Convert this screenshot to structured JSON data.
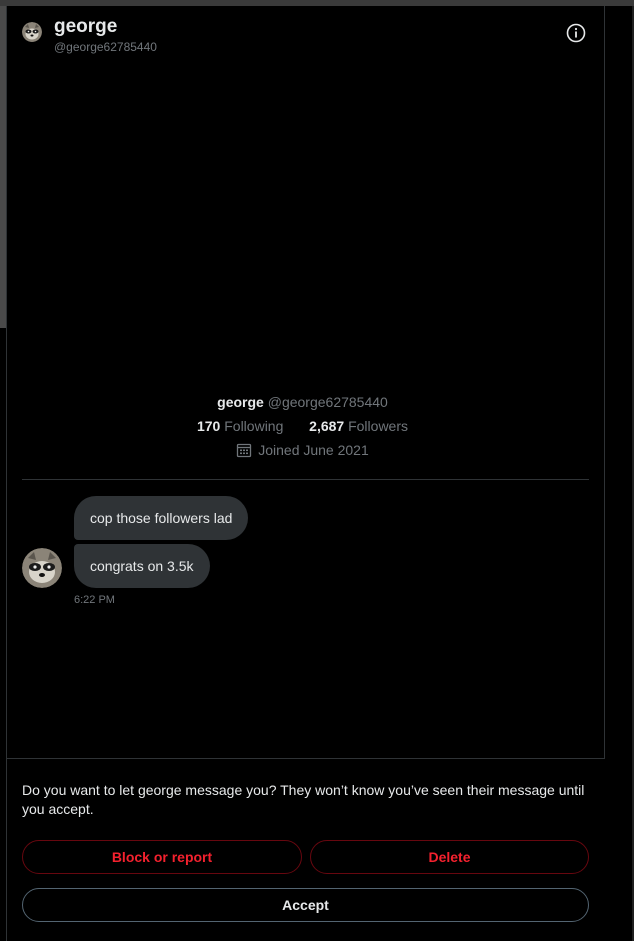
{
  "header": {
    "name": "george",
    "handle": "@george62785440",
    "info_icon": "info-circle-icon"
  },
  "profile": {
    "name": "george",
    "handle": "@george62785440",
    "following_count": "170",
    "following_label": "Following",
    "followers_count": "2,687",
    "followers_label": "Followers",
    "joined": "Joined June 2021",
    "calendar_icon": "calendar-icon"
  },
  "messages": [
    {
      "text": "cop those followers lad"
    },
    {
      "text": "congrats on 3.5k"
    }
  ],
  "message_time": "6:22 PM",
  "request": {
    "prompt": "Do you want to let george message you? They won’t know you’ve seen their message until you accept.",
    "block_label": "Block or report",
    "delete_label": "Delete",
    "accept_label": "Accept"
  },
  "colors": {
    "background": "#000000",
    "bubble": "#2f3336",
    "danger": "#f4212e",
    "secondary_text": "#71767b"
  }
}
